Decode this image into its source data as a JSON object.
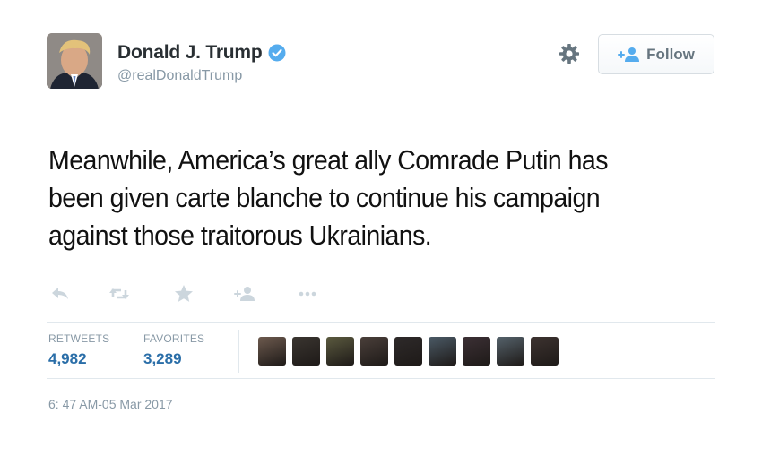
{
  "user": {
    "display_name": "Donald J. Trump",
    "handle": "@realDonaldTrump",
    "verified": true
  },
  "header_actions": {
    "follow_label": "Follow"
  },
  "tweet": {
    "lines": [
      "Meanwhile, America’s great ally Comrade Putin has",
      "been given carte blanche to continue his campaign",
      "against those traitorous Ukrainians."
    ]
  },
  "stats": {
    "retweets_label": "RETWEETS",
    "retweets_value": "4,982",
    "favorites_label": "FAVORITES",
    "favorites_value": "3,289"
  },
  "timestamp": "6: 47 AM-05 Mar 2017",
  "icons": {
    "reply": "reply-icon",
    "retweet": "retweet-icon",
    "favorite": "star-icon",
    "follow": "add-person-icon",
    "more": "more-dots-icon",
    "settings": "gear-icon",
    "verified": "verified-badge-icon"
  },
  "colors": {
    "link_blue": "#2a6ea8",
    "verified_blue": "#55acee",
    "muted_gray": "#8899a6",
    "icon_gray": "#ccd6dd"
  },
  "favoriters": [
    {
      "id": "favoriter-1",
      "tone": "#6d5a4e"
    },
    {
      "id": "favoriter-2",
      "tone": "#3a3530"
    },
    {
      "id": "favoriter-3",
      "tone": "#5b5a3f"
    },
    {
      "id": "favoriter-4",
      "tone": "#4a3f3a"
    },
    {
      "id": "favoriter-5",
      "tone": "#2e2a2a"
    },
    {
      "id": "favoriter-6",
      "tone": "#4b5a66"
    },
    {
      "id": "favoriter-7",
      "tone": "#3c3035"
    },
    {
      "id": "favoriter-8",
      "tone": "#55626b"
    },
    {
      "id": "favoriter-9",
      "tone": "#3d3330"
    }
  ]
}
